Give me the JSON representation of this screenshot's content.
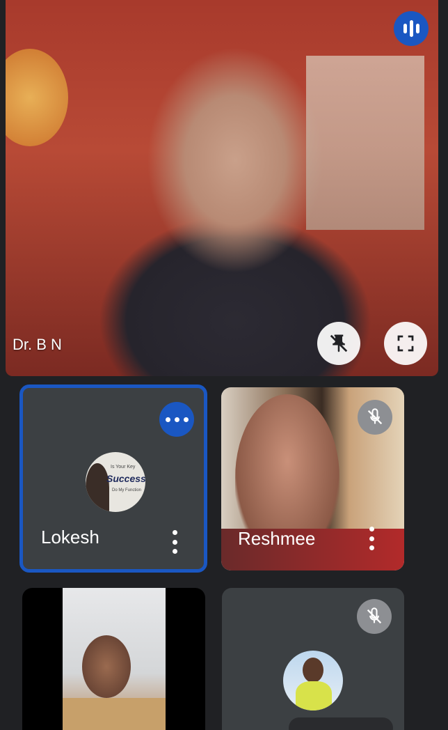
{
  "main_speaker": {
    "label": "Dr. B N",
    "speaking_icon": "audio-levels-icon",
    "pin_button_icon": "unpin-icon",
    "fullscreen_button_icon": "fullscreen-icon"
  },
  "tiles": [
    {
      "name": "Lokesh",
      "active": true,
      "status_icon": "speaking-dots-icon",
      "avatar_text": "Success",
      "avatar_caption": "Is Your Key",
      "avatar_subcaption": "Do My Function"
    },
    {
      "name": "Reshmee",
      "active": false,
      "status_icon": "mic-off-icon"
    },
    {
      "name": "",
      "active": false,
      "status_icon": ""
    },
    {
      "name": "",
      "active": false,
      "status_icon": "mic-off-icon"
    }
  ],
  "colors": {
    "background": "#202124",
    "tile": "#3c4043",
    "accent": "#1a57c2",
    "muted_badge": "#8d8f93"
  }
}
